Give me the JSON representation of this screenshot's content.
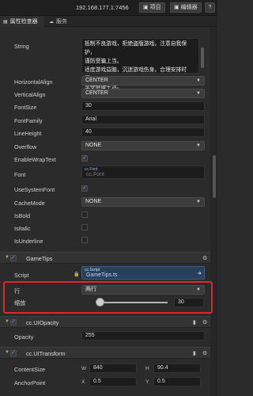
{
  "toolbar": {
    "ip_address": "192.168.177.1:7456",
    "project_label": "项目",
    "editor_label": "编辑器",
    "help_label": "?"
  },
  "tabs": [
    {
      "label": "属性检查器"
    },
    {
      "label": "服务"
    }
  ],
  "label_props": {
    "string_label": "String",
    "string_lines": [
      "抵制不良游戏，拒绝盗版游戏。注意自我保护，",
      "谨防受骗上当。",
      "适度游戏益脑，沉迷游戏伤身。合理安排时间，",
      "享受健康生活。"
    ],
    "horizontal_align_label": "HorizontalAlign",
    "horizontal_align_value": "CENTER",
    "vertical_align_label": "VerticalAlign",
    "vertical_align_value": "CENTER",
    "font_size_label": "FontSize",
    "font_size_value": "30",
    "font_family_label": "FontFamily",
    "font_family_value": "Arial",
    "line_height_label": "LineHeight",
    "line_height_value": "40",
    "overflow_label": "Overflow",
    "overflow_value": "NONE",
    "enable_wrap_label": "EnableWrapText",
    "enable_wrap_checked": true,
    "font_label": "Font",
    "font_tag": "cc.Font",
    "font_value": "cc.Font",
    "use_system_font_label": "UseSystemFont",
    "use_system_font_checked": true,
    "cache_mode_label": "CacheMode",
    "cache_mode_value": "NONE",
    "is_bold_label": "IsBold",
    "is_italic_label": "IsItalic",
    "is_underline_label": "IsUnderline"
  },
  "game_tips": {
    "title": "GameTips",
    "enabled": true,
    "script_label": "Script",
    "script_tag": "cc.Script",
    "script_value": "GameTips.ts",
    "row_label": "行",
    "row_value": "两行",
    "scale_label": "缩放",
    "scale_value": "30",
    "scale_fraction": 0.04
  },
  "ui_opacity": {
    "title": "cc.UIOpacity",
    "opacity_label": "Opacity",
    "opacity_value": "255"
  },
  "ui_transform": {
    "title": "cc.UITransform",
    "content_size_label": "ContentSize",
    "content_w_label": "W",
    "content_w_value": "840",
    "content_h_label": "H",
    "content_h_value": "90.4",
    "anchor_label": "AnchorPoint",
    "anchor_x_label": "X",
    "anchor_x_value": "0.5",
    "anchor_y_label": "Y",
    "anchor_y_value": "0.5"
  },
  "colors": {
    "highlight_border": "#e0262e",
    "check_accent": "#4aa0ff"
  },
  "icons": {
    "lock": "lock-icon",
    "gear": "gear-icon",
    "book": "book-icon",
    "folder": "folder-icon",
    "arrow": "arrow-icon"
  }
}
